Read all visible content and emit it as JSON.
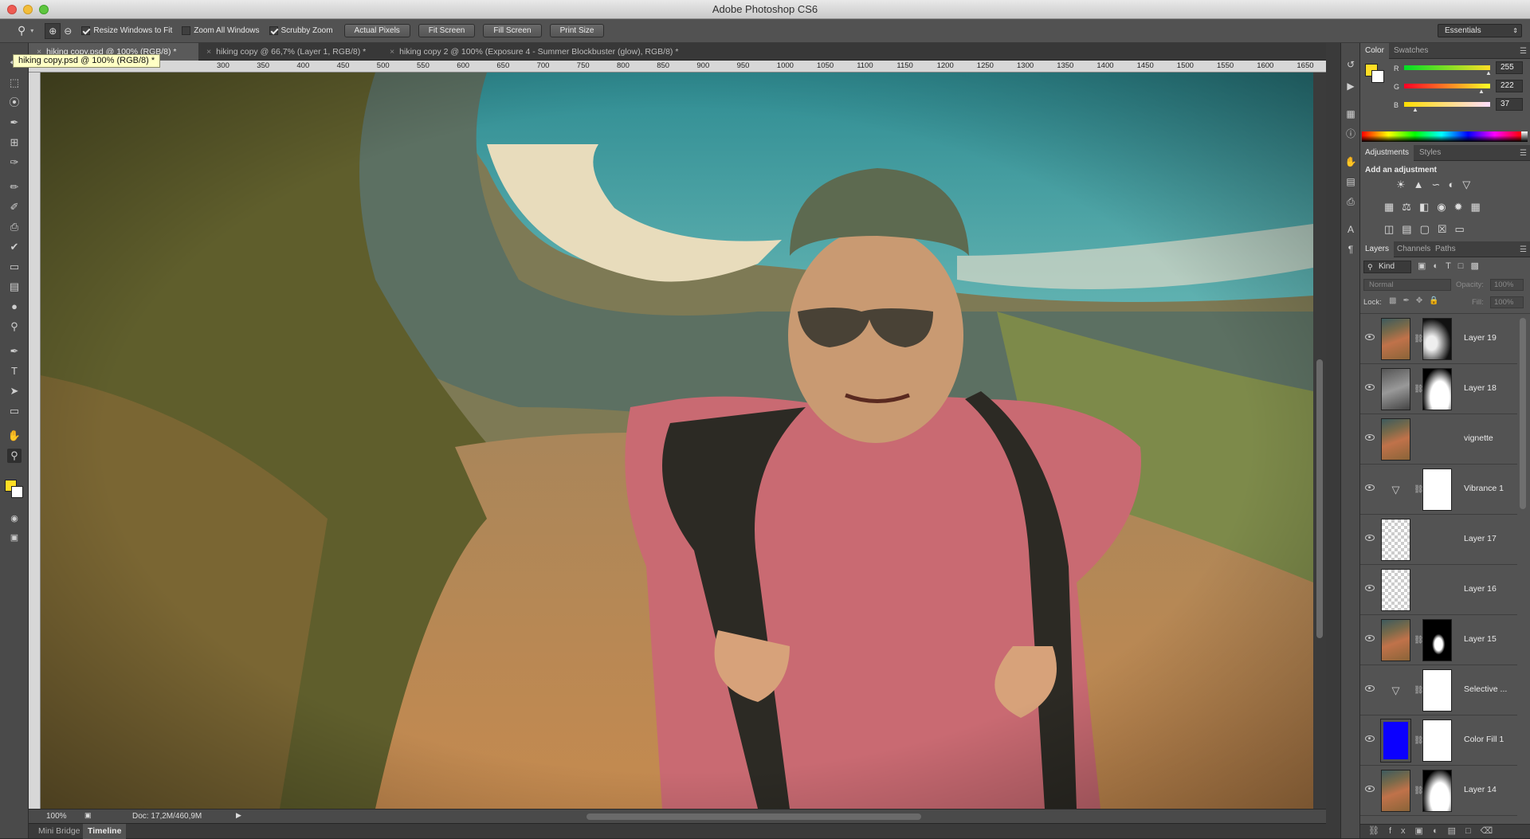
{
  "app": {
    "title": "Adobe Photoshop CS6"
  },
  "options": {
    "resize_windows": "Resize Windows to Fit",
    "zoom_all": "Zoom All Windows",
    "scrubby_zoom": "Scrubby Zoom",
    "actual_pixels": "Actual Pixels",
    "fit_screen": "Fit Screen",
    "fill_screen": "Fill Screen",
    "print_size": "Print Size",
    "workspace": "Essentials"
  },
  "doc_tabs": [
    {
      "label": "hiking copy.psd @ 100% (RGB/8) *"
    },
    {
      "label": "hiking copy @ 66,7% (Layer 1, RGB/8) *"
    },
    {
      "label": "hiking copy 2 @ 100% (Exposure 4 - Summer Blockbuster (glow), RGB/8) *"
    }
  ],
  "tooltip": "hiking copy.psd @ 100% (RGB/8) *",
  "ruler": {
    "h": [
      "300",
      "350",
      "400",
      "450",
      "500",
      "550",
      "600",
      "650",
      "700",
      "750",
      "800",
      "850",
      "900",
      "950",
      "1000",
      "1050",
      "1100",
      "1150",
      "1200",
      "1250",
      "1300",
      "1350",
      "1400",
      "1450",
      "1500",
      "1550",
      "1600",
      "1650"
    ]
  },
  "status": {
    "zoom": "100%",
    "doc": "Doc: 17,2M/460,9M"
  },
  "bottom_tabs": {
    "mini_bridge": "Mini Bridge",
    "timeline": "Timeline"
  },
  "color_panel": {
    "tab_color": "Color",
    "tab_swatches": "Swatches",
    "r_label": "R",
    "g_label": "G",
    "b_label": "B",
    "r": "255",
    "g": "222",
    "b": "37",
    "fg_color": "#ffde25",
    "bg_color": "#ffffff"
  },
  "adjustments": {
    "tab_adjustments": "Adjustments",
    "tab_styles": "Styles",
    "heading": "Add an adjustment"
  },
  "layers_panel": {
    "tab_layers": "Layers",
    "tab_channels": "Channels",
    "tab_paths": "Paths",
    "kind": "Kind",
    "blend": "Normal",
    "opacity_label": "Opacity:",
    "opacity": "100%",
    "lock_label": "Lock:",
    "fill_label": "Fill:",
    "fill": "100%",
    "layers": [
      {
        "name": "Layer 19",
        "thumb": "photo",
        "mask": "dark"
      },
      {
        "name": "Layer 18",
        "thumb": "photo-bw",
        "mask": "white-shape"
      },
      {
        "name": "vignette",
        "thumb": "photo",
        "mask": "none"
      },
      {
        "name": "Vibrance 1",
        "thumb": "adjust-icon",
        "mask": "white"
      },
      {
        "name": "Layer 17",
        "thumb": "transparent",
        "mask": "none"
      },
      {
        "name": "Layer 16",
        "thumb": "transparent",
        "mask": "none"
      },
      {
        "name": "Layer 15",
        "thumb": "photo",
        "mask": "silhouette"
      },
      {
        "name": "Selective ...",
        "thumb": "adjust-icon",
        "mask": "white"
      },
      {
        "name": "Color Fill 1",
        "thumb": "blue",
        "mask": "white"
      },
      {
        "name": "Layer 14",
        "thumb": "photo",
        "mask": "white-shape"
      }
    ]
  }
}
